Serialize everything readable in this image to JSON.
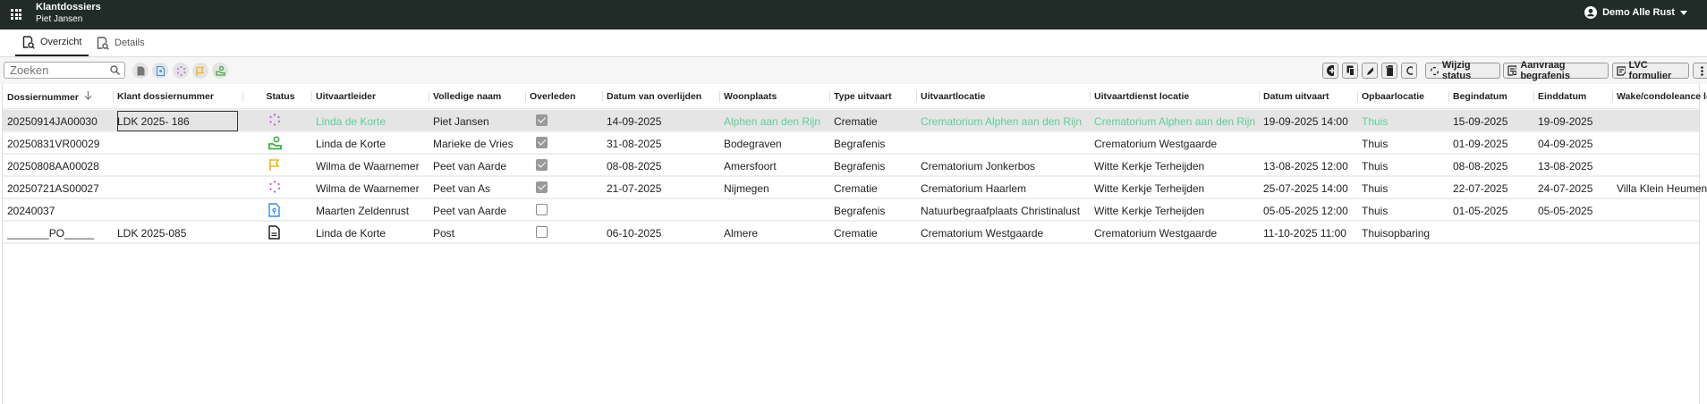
{
  "header": {
    "title": "Klantdossiers",
    "subtitle": "Piet Jansen",
    "user": "Demo Alle Rust",
    "bg": "#212c28"
  },
  "tabs": [
    {
      "label": "Overzicht",
      "active": true
    },
    {
      "label": "Details",
      "active": false
    }
  ],
  "toolbar": {
    "search_placeholder": "Zoeken",
    "filters": [
      "document",
      "file-pin",
      "spinner-dots",
      "flag",
      "handshake"
    ],
    "icon_buttons": [
      "add",
      "copy",
      "edit",
      "delete",
      "refresh"
    ],
    "buttons": [
      "Wijzig status",
      "Aanvraag begrafenis",
      "LVC formulier"
    ]
  },
  "columns": [
    "Dossiernummer",
    "Klant dossiernummer",
    "Status",
    "Uitvaartleider",
    "Volledige naam",
    "Overleden",
    "Datum van overlijden",
    "Woonplaats",
    "Type uitvaart",
    "Uitvaartlocatie",
    "Uitvaartdienst locatie",
    "Datum uitvaart",
    "Opbaarlocatie",
    "Begindatum",
    "Einddatum",
    "Wake/condoleance locatie"
  ],
  "sort": {
    "column": "Dossiernummer",
    "direction": "desc"
  },
  "rows": [
    {
      "c": [
        "20250914JA00030",
        "LDK 2025- 186",
        "",
        "Linda de Korte",
        "Piet Jansen",
        "",
        "14-09-2025",
        "Alphen aan den Rijn",
        "Crematie",
        "Crematorium Alphen aan den Rijn",
        "Crematorium Alphen aan den Rijn",
        "19-09-2025 14:00",
        "Thuis",
        "15-09-2025",
        "19-09-2025",
        ""
      ],
      "status": "spinner-dots",
      "overleden": true,
      "selected": true
    },
    {
      "c": [
        "20250831VR00029",
        "",
        "",
        "Linda de Korte",
        "Marieke de Vries",
        "",
        "31-08-2025",
        "Bodegraven",
        "Begrafenis",
        "",
        "Crematorium Westgaarde",
        "",
        "Thuis",
        "01-09-2025",
        "04-09-2025",
        ""
      ],
      "status": "handshake",
      "overleden": true
    },
    {
      "c": [
        "20250808AA00028",
        "",
        "",
        "Wilma de Waarnemer",
        "Peet van Aarde",
        "",
        "08-08-2025",
        "Amersfoort",
        "Begrafenis",
        "Crematorium Jonkerbos",
        "Witte Kerkje Terheijden",
        "13-08-2025 12:00",
        "Thuis",
        "08-08-2025",
        "13-08-2025",
        ""
      ],
      "status": "flag",
      "overleden": true
    },
    {
      "c": [
        "20250721AS00027",
        "",
        "",
        "Wilma de Waarnemer",
        "Peet van As",
        "",
        "21-07-2025",
        "Nijmegen",
        "Crematie",
        "Crematorium Haarlem",
        "Witte Kerkje Terheijden",
        "25-07-2025 14:00",
        "Thuis",
        "22-07-2025",
        "24-07-2025",
        "Villa Klein Heumen"
      ],
      "status": "spinner-dots",
      "overleden": true
    },
    {
      "c": [
        "20240037",
        "",
        "",
        "Maarten Zeldenrust",
        "Peet van Aarde",
        "",
        "",
        "",
        "Begrafenis",
        "Natuurbegraafplaats Christinalust",
        "Witte Kerkje Terheijden",
        "05-05-2025 12:00",
        "Thuis",
        "01-05-2025",
        "05-05-2025",
        ""
      ],
      "status": "file-pin",
      "overleden": false
    },
    {
      "c": [
        "_______PO_____",
        "LDK 2025-085",
        "",
        "Linda de Korte",
        "Post",
        "",
        "06-10-2025",
        "Almere",
        "Crematie",
        "Crematorium Westgaarde",
        "Crematorium Westgaarde",
        "11-10-2025 11:00",
        "Thuisopbaring",
        "",
        "",
        ""
      ],
      "status": "document",
      "overleden": false
    }
  ],
  "colors": {
    "highlight": "#5fcf9a",
    "spinner": "#c46be0",
    "flag": "#f2b705",
    "handshake": "#3cb043",
    "file": "#2f8fe8"
  }
}
